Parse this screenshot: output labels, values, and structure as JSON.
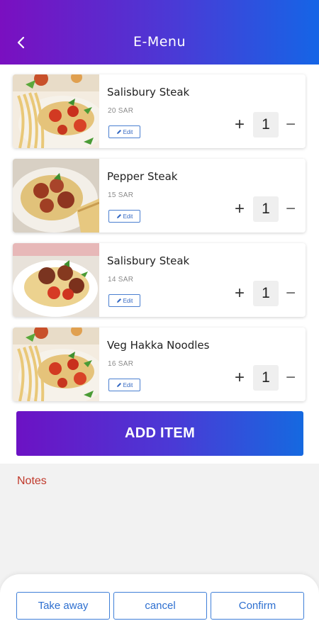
{
  "header": {
    "title": "E-Menu"
  },
  "items": [
    {
      "name": "Salisbury Steak",
      "price": "20 SAR",
      "edit_label": "Edit",
      "qty": "1",
      "image": "spaghetti-tomato-basil"
    },
    {
      "name": "Pepper Steak",
      "price": "15 SAR",
      "edit_label": "Edit",
      "qty": "1",
      "image": "spaghetti-meat-garlic-bread"
    },
    {
      "name": "Salisbury Steak",
      "price": "14 SAR",
      "edit_label": "Edit",
      "qty": "1",
      "image": "spaghetti-meatballs"
    },
    {
      "name": "Veg Hakka Noodles",
      "price": "16 SAR",
      "edit_label": "Edit",
      "qty": "1",
      "image": "spaghetti-tomato-basil"
    }
  ],
  "controls": {
    "plus": "+",
    "minus": "−"
  },
  "add_item_label": "ADD ITEM",
  "notes": {
    "label": "Notes"
  },
  "actions": {
    "take_away": "Take away",
    "cancel": "cancel",
    "confirm": "Confirm"
  },
  "colors": {
    "accent_start": "#7a0fc0",
    "accent_end": "#1565e6",
    "notes_label": "#c0392b",
    "outline": "#3f7fd8"
  }
}
